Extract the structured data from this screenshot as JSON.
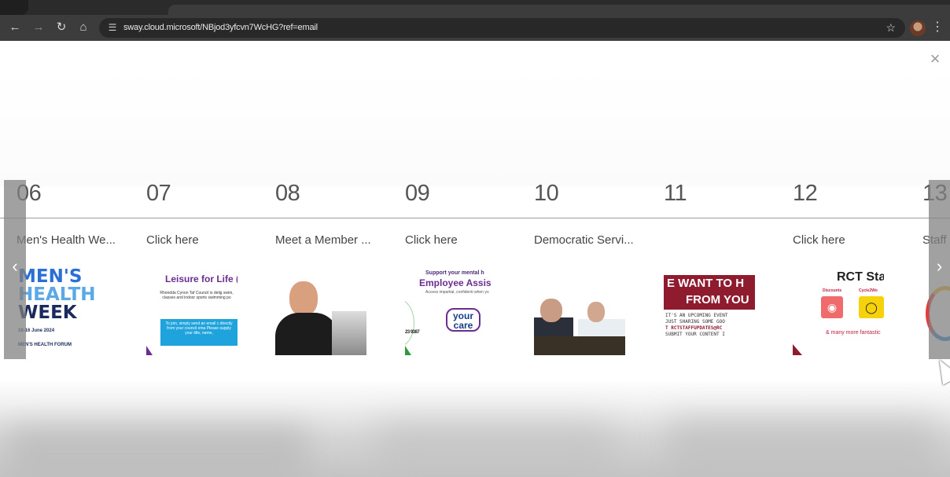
{
  "browser": {
    "url": "sway.cloud.microsoft/NBjod3yfcvn7WcHG?ref=email",
    "icons": [
      "back-icon",
      "forward-icon",
      "reload-icon",
      "home-icon",
      "site-settings-icon",
      "bookmark-star-icon",
      "profile-avatar",
      "menu-icon"
    ]
  },
  "navigation": {
    "prev_glyph": "‹",
    "next_glyph": "›",
    "close_glyph": "×"
  },
  "slides": [
    {
      "number": "06",
      "caption": "Men's Health We...",
      "thumb": {
        "line1": "MEN'S",
        "line2": "HEALTH",
        "line3": "WEEK",
        "date": "10-16 June 2024",
        "org": "MEN'S HEALTH FORUM"
      }
    },
    {
      "number": "07",
      "caption": "Click here",
      "thumb": {
        "title": "Leisure for Life (",
        "body": "Rhondda Cynon Taf Council is delig swim, classes and indoor sports swimming po",
        "box": "To join, simply send an email c directly from your council ema Please supply your title, name,"
      }
    },
    {
      "number": "08",
      "caption": "Meet a Member ..."
    },
    {
      "number": "09",
      "caption": "Click here",
      "thumb": {
        "line1": "Support your mental h",
        "line2": "Employee Assis",
        "line3": "Access impartial, confidenti when yo",
        "logo_top": "your",
        "logo_bottom": "care",
        "phone": "23 9387"
      }
    },
    {
      "number": "10",
      "caption": "Democratic Servi..."
    },
    {
      "number": "11",
      "caption": "",
      "thumb": {
        "band1": "E WANT TO H",
        "band2": "FROM YOU",
        "small1": "IT'S AN UPCOMING EVENT",
        "small2": "JUST SHARING SOME GOO",
        "small3": "T RCTSTAFFUPDATES@RC",
        "small4": "SUBMIT YOUR CONTENT I"
      }
    },
    {
      "number": "12",
      "caption": "Click here",
      "thumb": {
        "title": "RCT Sta",
        "label1": "Discounts",
        "label2": "Cycle2Wo",
        "more": "& many more fantastic"
      }
    },
    {
      "number": "13",
      "caption": "Staff"
    }
  ]
}
